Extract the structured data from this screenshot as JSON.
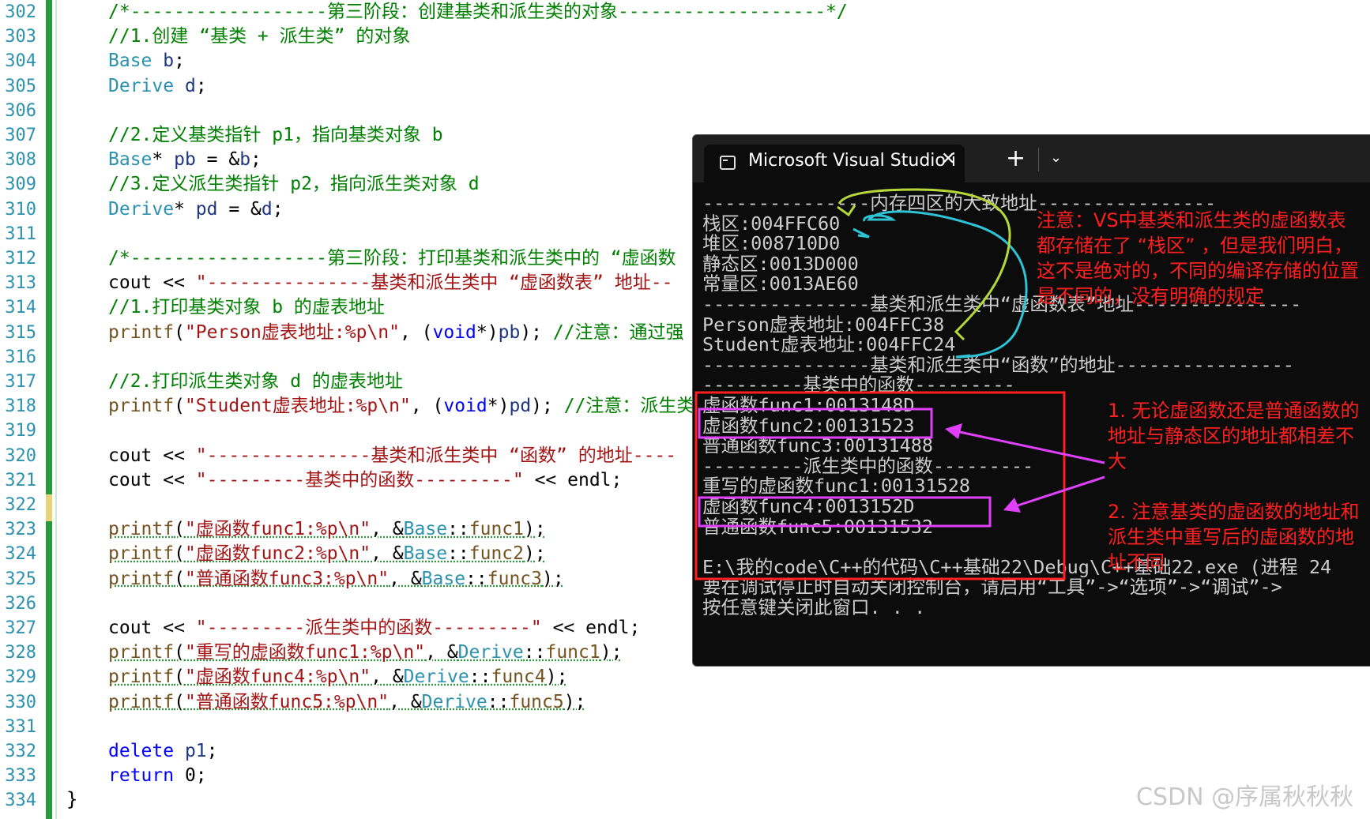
{
  "editor": {
    "lines": [
      {
        "n": "302",
        "parts": [
          [
            "cm",
            "/*------------------第三阶段：创建基类和派生类的对象-------------------*/"
          ]
        ]
      },
      {
        "n": "303",
        "parts": [
          [
            "cm",
            "//1.创建 “基类 + 派生类” 的对象"
          ]
        ]
      },
      {
        "n": "304",
        "parts": [
          [
            "ty",
            "Base"
          ],
          [
            "",
            " "
          ],
          [
            "ident",
            "b"
          ],
          [
            "",
            ";"
          ]
        ]
      },
      {
        "n": "305",
        "parts": [
          [
            "ty",
            "Derive"
          ],
          [
            "",
            " "
          ],
          [
            "ident",
            "d"
          ],
          [
            "",
            ";"
          ]
        ]
      },
      {
        "n": "306",
        "parts": []
      },
      {
        "n": "307",
        "parts": [
          [
            "cm",
            "//2.定义基类指针 p1，指向基类对象 b"
          ]
        ]
      },
      {
        "n": "308",
        "parts": [
          [
            "ty",
            "Base"
          ],
          [
            "",
            "* "
          ],
          [
            "ident",
            "pb"
          ],
          [
            "",
            " = &"
          ],
          [
            "ident",
            "b"
          ],
          [
            "",
            ";"
          ]
        ]
      },
      {
        "n": "309",
        "parts": [
          [
            "cm",
            "//3.定义派生类指针 p2，指向派生类对象 d"
          ]
        ]
      },
      {
        "n": "310",
        "parts": [
          [
            "ty",
            "Derive"
          ],
          [
            "",
            "* "
          ],
          [
            "ident",
            "pd"
          ],
          [
            "",
            " = &"
          ],
          [
            "ident",
            "d"
          ],
          [
            "",
            ";"
          ]
        ]
      },
      {
        "n": "311",
        "parts": []
      },
      {
        "n": "312",
        "parts": [
          [
            "cm",
            "/*------------------第三阶段：打印基类和派生类中的 “虚函数"
          ]
        ]
      },
      {
        "n": "313",
        "parts": [
          [
            "",
            "cout << "
          ],
          [
            "st",
            "\"---------------基类和派生类中 “虚函数表” 地址--"
          ]
        ]
      },
      {
        "n": "314",
        "parts": [
          [
            "cm",
            "//1.打印基类对象 b 的虚表地址"
          ]
        ]
      },
      {
        "n": "315",
        "parts": [
          [
            "fn",
            "printf"
          ],
          [
            "",
            "("
          ],
          [
            "st",
            "\"Person虚表地址:%p\\n\""
          ],
          [
            "",
            ", ("
          ],
          [
            "kw",
            "void"
          ],
          [
            "",
            "*)"
          ],
          [
            "ident",
            "pb"
          ],
          [
            "",
            "); "
          ],
          [
            "cm",
            "//注意：通过强"
          ]
        ]
      },
      {
        "n": "316",
        "parts": []
      },
      {
        "n": "317",
        "parts": [
          [
            "cm",
            "//2.打印派生类对象 d 的虚表地址"
          ]
        ]
      },
      {
        "n": "318",
        "parts": [
          [
            "fn",
            "printf"
          ],
          [
            "",
            "("
          ],
          [
            "st",
            "\"Student虚表地址:%p\\n\""
          ],
          [
            "",
            ", ("
          ],
          [
            "kw",
            "void"
          ],
          [
            "",
            "*)"
          ],
          [
            "ident",
            "pd"
          ],
          [
            "",
            "); "
          ],
          [
            "cm",
            "//注意：派生类"
          ]
        ]
      },
      {
        "n": "319",
        "parts": []
      },
      {
        "n": "320",
        "parts": [
          [
            "",
            "cout << "
          ],
          [
            "st",
            "\"---------------基类和派生类中 “函数” 的地址----"
          ]
        ]
      },
      {
        "n": "321",
        "parts": [
          [
            "",
            "cout << "
          ],
          [
            "st",
            "\"---------基类中的函数---------\""
          ],
          [
            "",
            " << endl;"
          ]
        ]
      },
      {
        "n": "322",
        "parts": []
      },
      {
        "n": "323",
        "parts": [
          [
            "fn",
            "printf"
          ],
          [
            "",
            "("
          ],
          [
            "st",
            "\"虚函数func1:%p\\n\""
          ],
          [
            "",
            ", &"
          ],
          [
            "ty",
            "Base"
          ],
          [
            "",
            "::"
          ],
          [
            "fn",
            "func1"
          ],
          [
            "",
            ");"
          ]
        ]
      },
      {
        "n": "324",
        "parts": [
          [
            "fn",
            "printf"
          ],
          [
            "",
            "("
          ],
          [
            "st",
            "\"虚函数func2:%p\\n\""
          ],
          [
            "",
            ", &"
          ],
          [
            "ty",
            "Base"
          ],
          [
            "",
            "::"
          ],
          [
            "fn",
            "func2"
          ],
          [
            "",
            ");"
          ]
        ]
      },
      {
        "n": "325",
        "parts": [
          [
            "fn",
            "printf"
          ],
          [
            "",
            "("
          ],
          [
            "st",
            "\"普通函数func3:%p\\n\""
          ],
          [
            "",
            ", &"
          ],
          [
            "ty",
            "Base"
          ],
          [
            "",
            "::"
          ],
          [
            "fn",
            "func3"
          ],
          [
            "",
            ");"
          ]
        ]
      },
      {
        "n": "326",
        "parts": []
      },
      {
        "n": "327",
        "parts": [
          [
            "",
            "cout << "
          ],
          [
            "st",
            "\"---------派生类中的函数---------\""
          ],
          [
            "",
            " << endl;"
          ]
        ]
      },
      {
        "n": "328",
        "parts": [
          [
            "fn",
            "printf"
          ],
          [
            "",
            "("
          ],
          [
            "st",
            "\"重写的虚函数func1:%p\\n\""
          ],
          [
            "",
            ", &"
          ],
          [
            "ty",
            "Derive"
          ],
          [
            "",
            "::"
          ],
          [
            "fn",
            "func1"
          ],
          [
            "",
            ");"
          ]
        ]
      },
      {
        "n": "329",
        "parts": [
          [
            "fn",
            "printf"
          ],
          [
            "",
            "("
          ],
          [
            "st",
            "\"虚函数func4:%p\\n\""
          ],
          [
            "",
            ", &"
          ],
          [
            "ty",
            "Derive"
          ],
          [
            "",
            "::"
          ],
          [
            "fn",
            "func4"
          ],
          [
            "",
            ");"
          ]
        ]
      },
      {
        "n": "330",
        "parts": [
          [
            "fn",
            "printf"
          ],
          [
            "",
            "("
          ],
          [
            "st",
            "\"普通函数func5:%p\\n\""
          ],
          [
            "",
            ", &"
          ],
          [
            "ty",
            "Derive"
          ],
          [
            "",
            "::"
          ],
          [
            "fn",
            "func5"
          ],
          [
            "",
            ");"
          ]
        ]
      },
      {
        "n": "331",
        "parts": []
      },
      {
        "n": "332",
        "parts": [
          [
            "kw",
            "delete"
          ],
          [
            "",
            " "
          ],
          [
            "ident",
            "p1"
          ],
          [
            "",
            ";"
          ]
        ]
      },
      {
        "n": "333",
        "parts": [
          [
            "kw",
            "return"
          ],
          [
            "",
            " 0;"
          ]
        ]
      },
      {
        "n": "334",
        "parts": []
      }
    ],
    "closing_brace": "}"
  },
  "console": {
    "tab_title": "Microsoft Visual Studio i",
    "tab_close": "✕",
    "tab_add": "+",
    "tab_menu": "⌄",
    "lines": [
      "---------------内存四区的大致地址----------------",
      "栈区:004FFC60",
      "堆区:008710D0",
      "静态区:0013D000",
      "常量区:0013AE60",
      "---------------基类和派生类中“虚函数表”地址---------------",
      "Person虚表地址:004FFC38",
      "Student虚表地址:004FFC24",
      "---------------基类和派生类中“函数”的地址----------------",
      "---------基类中的函数---------",
      "虚函数func1:0013148D",
      "虚函数func2:00131523",
      "普通函数func3:00131488",
      "---------派生类中的函数---------",
      "重写的虚函数func1:00131528",
      "虚函数func4:0013152D",
      "普通函数func5:00131532",
      "",
      "E:\\我的code\\C++的代码\\C++基础22\\Debug\\C++基础22.exe (进程 24",
      "要在调试停止时自动关闭控制台，请启用“工具”->“选项”->“调试”->",
      "按任意键关闭此窗口. . ."
    ]
  },
  "annotations": {
    "note1": "注意：VS中基类和派生类的虚函数表\n都存储在了 “栈区” ，但是我们明白，\n这不是绝对的，不同的编译存储的位置\n是不同的，没有明确的规定",
    "note2": "1. 无论虚函数还是普通函数的\n地址与静态区的地址都相差不\n大",
    "note3": "2. 注意基类的虚函数的地址和\n派生类中重写后的虚函数的地\n址不同",
    "color_red": "#ff1f1f",
    "color_magenta": "#e040fb",
    "color_cyan": "#2ec4d6",
    "color_yellowgreen": "#b7d63a"
  },
  "watermark": "CSDN @序属秋秋秋"
}
